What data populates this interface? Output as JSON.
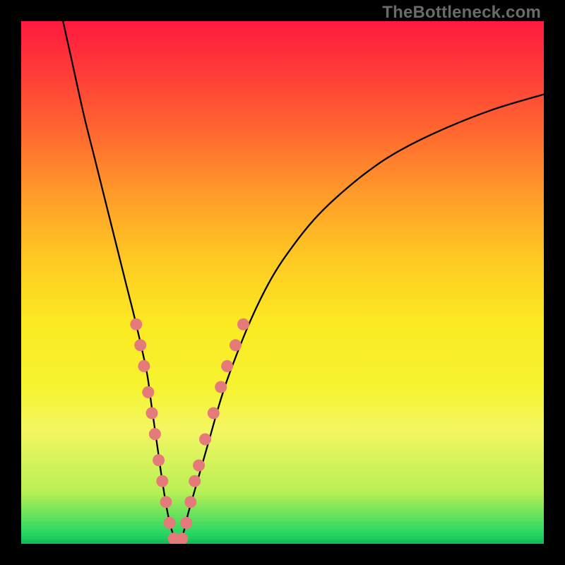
{
  "watermark": "TheBottleneck.com",
  "chart_data": {
    "type": "line",
    "title": "",
    "xlabel": "",
    "ylabel": "",
    "xlim": [
      0,
      100
    ],
    "ylim": [
      0,
      100
    ],
    "grid": false,
    "legend": false,
    "background_gradient_stops": [
      {
        "pos": 0.0,
        "color": "#ff1a3f"
      },
      {
        "pos": 0.3,
        "color": "#ff7a2c"
      },
      {
        "pos": 0.55,
        "color": "#ffd824"
      },
      {
        "pos": 0.78,
        "color": "#f4f352"
      },
      {
        "pos": 0.97,
        "color": "#34e26d"
      },
      {
        "pos": 1.0,
        "color": "#18c95a"
      }
    ],
    "series": [
      {
        "name": "bottleneck-curve",
        "x": [
          8,
          10,
          12,
          14,
          16,
          18,
          20,
          22,
          24,
          25,
          26,
          27,
          28,
          29,
          30,
          31,
          32,
          34,
          36,
          38,
          40,
          44,
          48,
          52,
          56,
          60,
          66,
          72,
          80,
          90,
          100
        ],
        "y": [
          100,
          91,
          82,
          74,
          66,
          58,
          50,
          42,
          33,
          26,
          19,
          12,
          6,
          2,
          0,
          2,
          6,
          13,
          20,
          27,
          33,
          43,
          51,
          57,
          62,
          66,
          71,
          75,
          79,
          83,
          86
        ]
      }
    ],
    "markers": {
      "name": "highlight-dots",
      "color": "#e47a7a",
      "points": [
        {
          "x": 22.0,
          "y": 42
        },
        {
          "x": 22.8,
          "y": 38
        },
        {
          "x": 23.5,
          "y": 34
        },
        {
          "x": 24.3,
          "y": 29
        },
        {
          "x": 25.0,
          "y": 25
        },
        {
          "x": 25.6,
          "y": 21
        },
        {
          "x": 26.3,
          "y": 16
        },
        {
          "x": 27.0,
          "y": 12
        },
        {
          "x": 27.7,
          "y": 8
        },
        {
          "x": 28.4,
          "y": 4
        },
        {
          "x": 29.2,
          "y": 1
        },
        {
          "x": 30.0,
          "y": 0
        },
        {
          "x": 30.8,
          "y": 1
        },
        {
          "x": 31.6,
          "y": 4
        },
        {
          "x": 32.4,
          "y": 8
        },
        {
          "x": 33.2,
          "y": 12
        },
        {
          "x": 34.0,
          "y": 15
        },
        {
          "x": 35.2,
          "y": 20
        },
        {
          "x": 36.8,
          "y": 25
        },
        {
          "x": 38.2,
          "y": 30
        },
        {
          "x": 39.4,
          "y": 34
        },
        {
          "x": 41.0,
          "y": 38
        },
        {
          "x": 42.5,
          "y": 42
        }
      ]
    }
  }
}
